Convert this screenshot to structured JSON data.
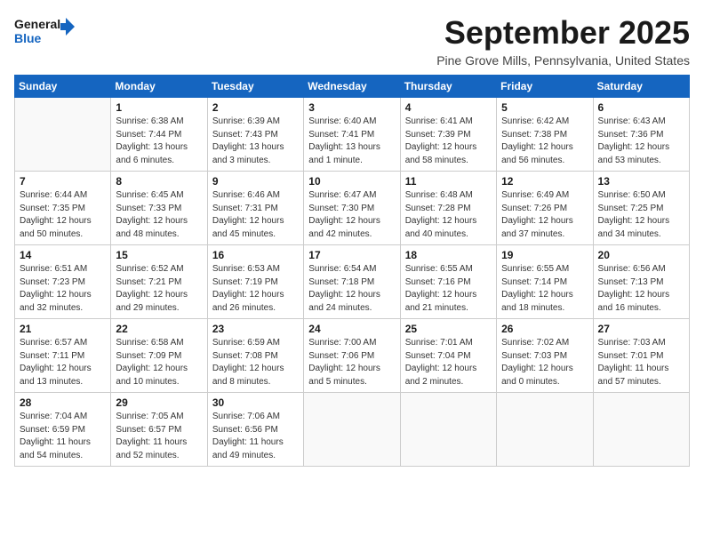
{
  "header": {
    "logo_line1": "General",
    "logo_line2": "Blue",
    "title": "September 2025",
    "location": "Pine Grove Mills, Pennsylvania, United States"
  },
  "weekdays": [
    "Sunday",
    "Monday",
    "Tuesday",
    "Wednesday",
    "Thursday",
    "Friday",
    "Saturday"
  ],
  "weeks": [
    [
      {
        "day": "",
        "sunrise": "",
        "sunset": "",
        "daylight": ""
      },
      {
        "day": "1",
        "sunrise": "Sunrise: 6:38 AM",
        "sunset": "Sunset: 7:44 PM",
        "daylight": "Daylight: 13 hours and 6 minutes."
      },
      {
        "day": "2",
        "sunrise": "Sunrise: 6:39 AM",
        "sunset": "Sunset: 7:43 PM",
        "daylight": "Daylight: 13 hours and 3 minutes."
      },
      {
        "day": "3",
        "sunrise": "Sunrise: 6:40 AM",
        "sunset": "Sunset: 7:41 PM",
        "daylight": "Daylight: 13 hours and 1 minute."
      },
      {
        "day": "4",
        "sunrise": "Sunrise: 6:41 AM",
        "sunset": "Sunset: 7:39 PM",
        "daylight": "Daylight: 12 hours and 58 minutes."
      },
      {
        "day": "5",
        "sunrise": "Sunrise: 6:42 AM",
        "sunset": "Sunset: 7:38 PM",
        "daylight": "Daylight: 12 hours and 56 minutes."
      },
      {
        "day": "6",
        "sunrise": "Sunrise: 6:43 AM",
        "sunset": "Sunset: 7:36 PM",
        "daylight": "Daylight: 12 hours and 53 minutes."
      }
    ],
    [
      {
        "day": "7",
        "sunrise": "Sunrise: 6:44 AM",
        "sunset": "Sunset: 7:35 PM",
        "daylight": "Daylight: 12 hours and 50 minutes."
      },
      {
        "day": "8",
        "sunrise": "Sunrise: 6:45 AM",
        "sunset": "Sunset: 7:33 PM",
        "daylight": "Daylight: 12 hours and 48 minutes."
      },
      {
        "day": "9",
        "sunrise": "Sunrise: 6:46 AM",
        "sunset": "Sunset: 7:31 PM",
        "daylight": "Daylight: 12 hours and 45 minutes."
      },
      {
        "day": "10",
        "sunrise": "Sunrise: 6:47 AM",
        "sunset": "Sunset: 7:30 PM",
        "daylight": "Daylight: 12 hours and 42 minutes."
      },
      {
        "day": "11",
        "sunrise": "Sunrise: 6:48 AM",
        "sunset": "Sunset: 7:28 PM",
        "daylight": "Daylight: 12 hours and 40 minutes."
      },
      {
        "day": "12",
        "sunrise": "Sunrise: 6:49 AM",
        "sunset": "Sunset: 7:26 PM",
        "daylight": "Daylight: 12 hours and 37 minutes."
      },
      {
        "day": "13",
        "sunrise": "Sunrise: 6:50 AM",
        "sunset": "Sunset: 7:25 PM",
        "daylight": "Daylight: 12 hours and 34 minutes."
      }
    ],
    [
      {
        "day": "14",
        "sunrise": "Sunrise: 6:51 AM",
        "sunset": "Sunset: 7:23 PM",
        "daylight": "Daylight: 12 hours and 32 minutes."
      },
      {
        "day": "15",
        "sunrise": "Sunrise: 6:52 AM",
        "sunset": "Sunset: 7:21 PM",
        "daylight": "Daylight: 12 hours and 29 minutes."
      },
      {
        "day": "16",
        "sunrise": "Sunrise: 6:53 AM",
        "sunset": "Sunset: 7:19 PM",
        "daylight": "Daylight: 12 hours and 26 minutes."
      },
      {
        "day": "17",
        "sunrise": "Sunrise: 6:54 AM",
        "sunset": "Sunset: 7:18 PM",
        "daylight": "Daylight: 12 hours and 24 minutes."
      },
      {
        "day": "18",
        "sunrise": "Sunrise: 6:55 AM",
        "sunset": "Sunset: 7:16 PM",
        "daylight": "Daylight: 12 hours and 21 minutes."
      },
      {
        "day": "19",
        "sunrise": "Sunrise: 6:55 AM",
        "sunset": "Sunset: 7:14 PM",
        "daylight": "Daylight: 12 hours and 18 minutes."
      },
      {
        "day": "20",
        "sunrise": "Sunrise: 6:56 AM",
        "sunset": "Sunset: 7:13 PM",
        "daylight": "Daylight: 12 hours and 16 minutes."
      }
    ],
    [
      {
        "day": "21",
        "sunrise": "Sunrise: 6:57 AM",
        "sunset": "Sunset: 7:11 PM",
        "daylight": "Daylight: 12 hours and 13 minutes."
      },
      {
        "day": "22",
        "sunrise": "Sunrise: 6:58 AM",
        "sunset": "Sunset: 7:09 PM",
        "daylight": "Daylight: 12 hours and 10 minutes."
      },
      {
        "day": "23",
        "sunrise": "Sunrise: 6:59 AM",
        "sunset": "Sunset: 7:08 PM",
        "daylight": "Daylight: 12 hours and 8 minutes."
      },
      {
        "day": "24",
        "sunrise": "Sunrise: 7:00 AM",
        "sunset": "Sunset: 7:06 PM",
        "daylight": "Daylight: 12 hours and 5 minutes."
      },
      {
        "day": "25",
        "sunrise": "Sunrise: 7:01 AM",
        "sunset": "Sunset: 7:04 PM",
        "daylight": "Daylight: 12 hours and 2 minutes."
      },
      {
        "day": "26",
        "sunrise": "Sunrise: 7:02 AM",
        "sunset": "Sunset: 7:03 PM",
        "daylight": "Daylight: 12 hours and 0 minutes."
      },
      {
        "day": "27",
        "sunrise": "Sunrise: 7:03 AM",
        "sunset": "Sunset: 7:01 PM",
        "daylight": "Daylight: 11 hours and 57 minutes."
      }
    ],
    [
      {
        "day": "28",
        "sunrise": "Sunrise: 7:04 AM",
        "sunset": "Sunset: 6:59 PM",
        "daylight": "Daylight: 11 hours and 54 minutes."
      },
      {
        "day": "29",
        "sunrise": "Sunrise: 7:05 AM",
        "sunset": "Sunset: 6:57 PM",
        "daylight": "Daylight: 11 hours and 52 minutes."
      },
      {
        "day": "30",
        "sunrise": "Sunrise: 7:06 AM",
        "sunset": "Sunset: 6:56 PM",
        "daylight": "Daylight: 11 hours and 49 minutes."
      },
      {
        "day": "",
        "sunrise": "",
        "sunset": "",
        "daylight": ""
      },
      {
        "day": "",
        "sunrise": "",
        "sunset": "",
        "daylight": ""
      },
      {
        "day": "",
        "sunrise": "",
        "sunset": "",
        "daylight": ""
      },
      {
        "day": "",
        "sunrise": "",
        "sunset": "",
        "daylight": ""
      }
    ]
  ]
}
